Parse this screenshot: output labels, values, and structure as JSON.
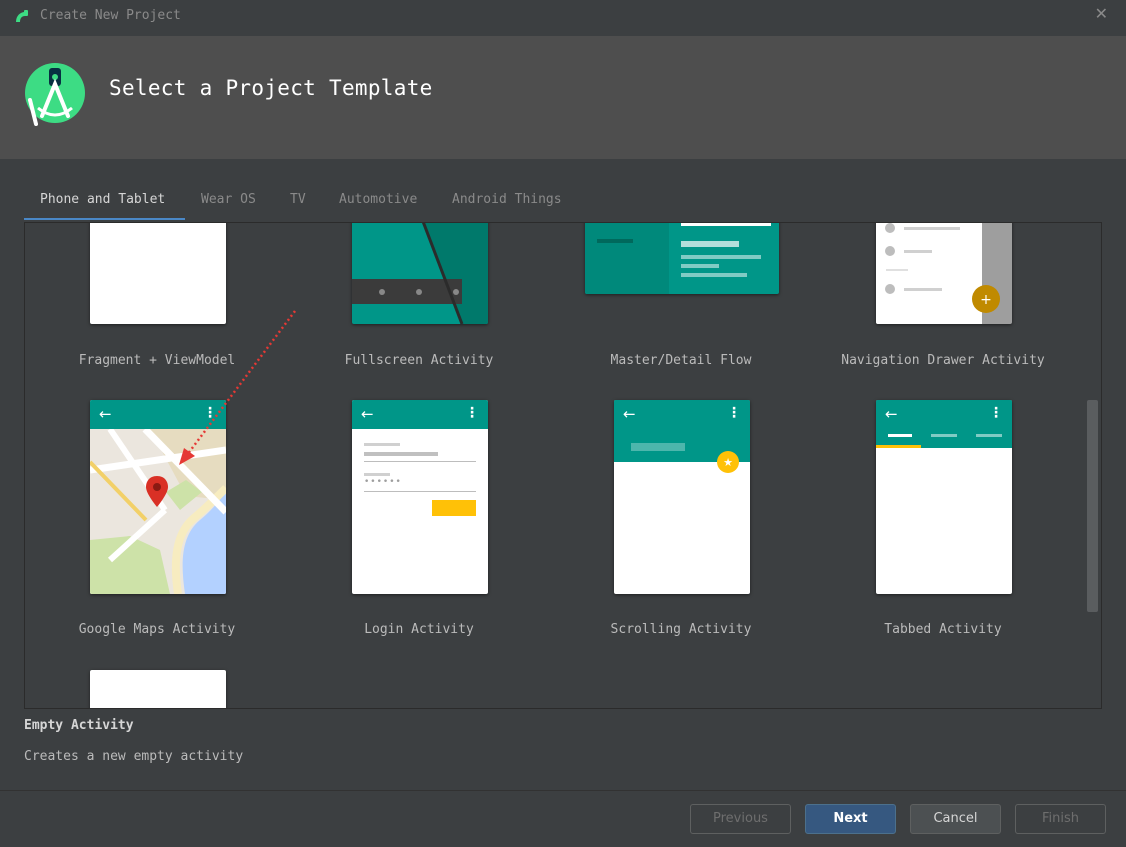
{
  "window": {
    "title": "Create New Project",
    "close_icon": "close-icon"
  },
  "header": {
    "title": "Select a Project Template",
    "logo_icon": "android-studio-logo"
  },
  "tabs": [
    {
      "label": "Phone and Tablet",
      "active": true
    },
    {
      "label": "Wear OS",
      "active": false
    },
    {
      "label": "TV",
      "active": false
    },
    {
      "label": "Automotive",
      "active": false
    },
    {
      "label": "Android Things",
      "active": false
    }
  ],
  "templates": [
    {
      "label": "Fragment + ViewModel"
    },
    {
      "label": "Fullscreen Activity"
    },
    {
      "label": "Master/Detail Flow"
    },
    {
      "label": "Navigation Drawer Activity"
    },
    {
      "label": "Google Maps Activity"
    },
    {
      "label": "Login Activity"
    },
    {
      "label": "Scrolling Activity"
    },
    {
      "label": "Tabbed Activity"
    },
    {
      "label": ""
    }
  ],
  "login_password_mask": "••••••",
  "selected": {
    "name": "Empty Activity",
    "description": "Creates a new empty activity"
  },
  "buttons": {
    "previous": "Previous",
    "next": "Next",
    "cancel": "Cancel",
    "finish": "Finish"
  },
  "colors": {
    "accent": "#009688",
    "primary_button": "#365880",
    "tab_underline": "#4a88c7",
    "fab": "#f4b400"
  }
}
